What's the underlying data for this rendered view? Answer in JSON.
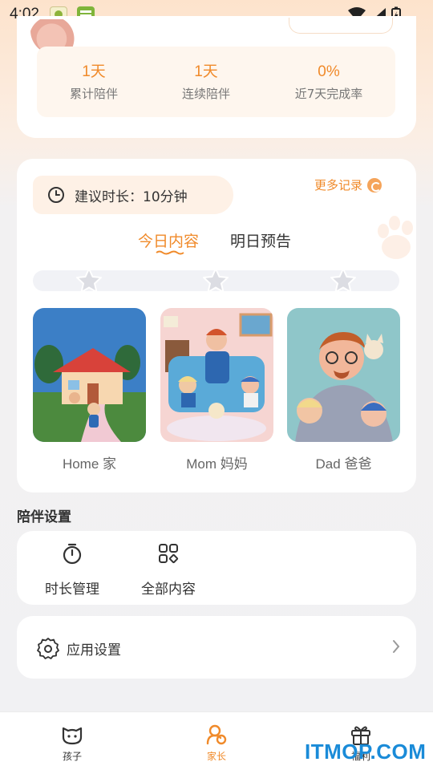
{
  "status_bar": {
    "time": "4:02"
  },
  "stats": [
    {
      "value": "1天",
      "label": "累计陪伴"
    },
    {
      "value": "1天",
      "label": "连续陪伴"
    },
    {
      "value": "0%",
      "label": "近7天完成率"
    }
  ],
  "content": {
    "more_records": "更多记录",
    "duration_hint": "建议时长：10分钟",
    "tabs": {
      "today": "今日内容",
      "tomorrow": "明日预告"
    },
    "progress_stars": 0,
    "stars_total": 3,
    "items": [
      {
        "label": "Home 家"
      },
      {
        "label": "Mom 妈妈"
      },
      {
        "label": "Dad 爸爸"
      }
    ]
  },
  "settings": {
    "section_title": "陪伴设置",
    "duration_manage": "时长管理",
    "all_content": "全部内容",
    "app_settings": "应用设置"
  },
  "bottom_nav": {
    "child": "孩子",
    "parent": "家长",
    "gift": "福利"
  },
  "watermark": "ITMOP.COM",
  "colors": {
    "accent": "#f08a2a",
    "star_inactive": "#dcdde3"
  }
}
